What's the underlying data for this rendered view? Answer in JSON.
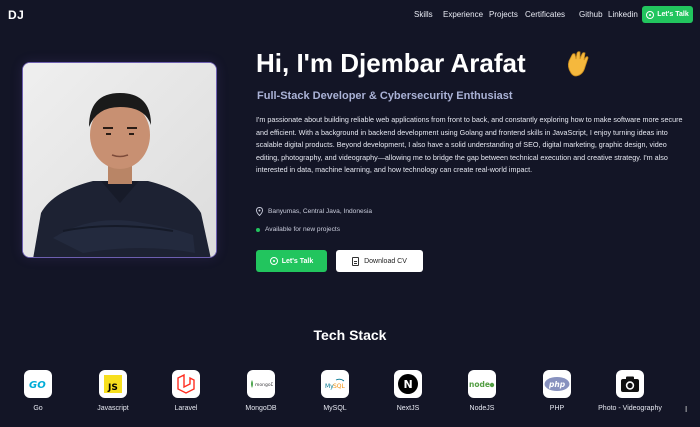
{
  "nav": {
    "logo": "DJ",
    "links": [
      "Skills",
      "Experience",
      "Projects",
      "Certificates"
    ],
    "external": [
      "Github",
      "Linkedin"
    ],
    "cta": "Let's Talk"
  },
  "hero": {
    "title": "Hi, I'm Djembar Arafat",
    "subtitle": "Full-Stack Developer & Cybersecurity Enthusiast",
    "bio": "I'm passionate about building reliable web applications from front to back, and constantly exploring how to make software more secure and efficient. With a background in backend development using Golang and frontend skills in JavaScript, I enjoy turning ideas into scalable digital products. Beyond development, I also have a solid understanding of SEO, digital marketing, graphic design, video editing, photography, and videography—allowing me to bridge the gap between technical execution and creative strategy. I'm also interested in data, machine learning, and how technology can create real-world impact.",
    "location": "Banyumas, Central Java, Indonesia",
    "availability": "Available for new projects",
    "btn_talk": "Let's Talk",
    "btn_cv": "Download CV"
  },
  "tech": {
    "title": "Tech Stack",
    "items": [
      "Go",
      "Javascript",
      "Laravel",
      "MongoDB",
      "MySQL",
      "NextJS",
      "NodeJS",
      "PHP",
      "Photo - Videography"
    ],
    "side_mark": "I"
  },
  "colors": {
    "background": "#131526",
    "accent_green": "#22c55e",
    "subtitle": "#aab2d6",
    "photo_border": "#6d5fb0"
  }
}
